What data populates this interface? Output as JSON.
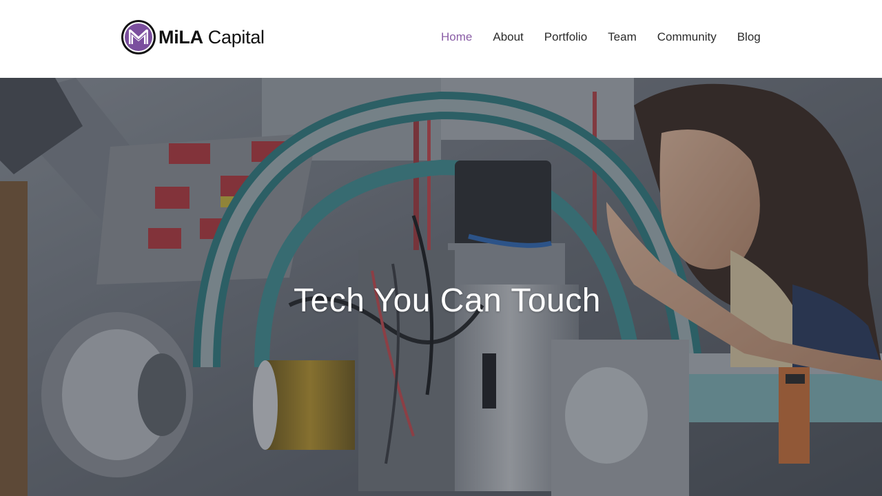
{
  "header": {
    "logo": {
      "icon": "mila-m-logo-icon",
      "brand_bold": "MiLA",
      "brand_light": "Capital",
      "accent_color": "#7b4f9e"
    },
    "nav": [
      {
        "label": "Home",
        "active": true
      },
      {
        "label": "About",
        "active": false
      },
      {
        "label": "Portfolio",
        "active": false
      },
      {
        "label": "Team",
        "active": false
      },
      {
        "label": "Community",
        "active": false
      },
      {
        "label": "Blog",
        "active": false
      }
    ],
    "active_color": "#8a5ea6"
  },
  "hero": {
    "title": "Tech You Can Touch",
    "image": "researcher-examining-lab-machinery-photo"
  }
}
